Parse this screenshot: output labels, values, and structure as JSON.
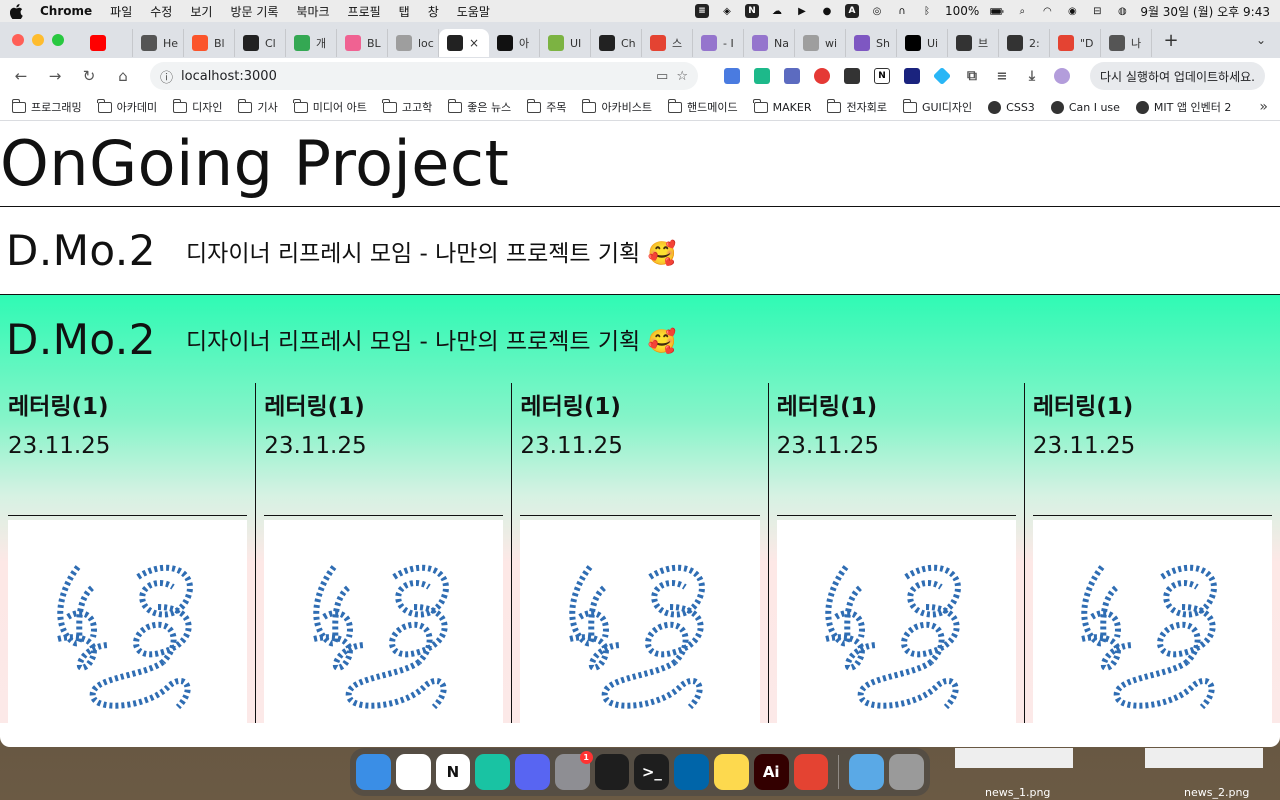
{
  "menubar": {
    "app_name": "Chrome",
    "menus": [
      "파일",
      "수정",
      "보기",
      "방문 기록",
      "북마크",
      "프로필",
      "탭",
      "창",
      "도움말"
    ],
    "battery": "100%",
    "datetime": "9월 30일 (월) 오후 9:43"
  },
  "tabs": [
    {
      "label": "",
      "icon": "youtube-icon",
      "color": "#ff0000"
    },
    {
      "label": "He",
      "icon": "chatgpt-icon",
      "color": "#555555"
    },
    {
      "label": "Bl",
      "icon": "brave-icon",
      "color": "#fb542b"
    },
    {
      "label": "Cl",
      "icon": "chatgpt-icon",
      "color": "#222222"
    },
    {
      "label": "개",
      "icon": "maps-icon",
      "color": "#34a853"
    },
    {
      "label": "BL",
      "icon": "bookmark-icon",
      "color": "#f06292"
    },
    {
      "label": "loc",
      "icon": "globe-icon",
      "color": "#9e9e9e"
    },
    {
      "label": "×",
      "icon": "react-icon",
      "color": "#222222",
      "active": true
    },
    {
      "label": "아",
      "icon": "app-icon",
      "color": "#111111"
    },
    {
      "label": "UI",
      "icon": "smile-icon",
      "color": "#7cb342"
    },
    {
      "label": "Ch",
      "icon": "chatgpt-icon",
      "color": "#222222"
    },
    {
      "label": "스",
      "icon": "todoist-icon",
      "color": "#e44332"
    },
    {
      "label": "- I",
      "icon": "stack-icon",
      "color": "#9575cd"
    },
    {
      "label": "Na",
      "icon": "stack-icon",
      "color": "#9575cd"
    },
    {
      "label": "wi",
      "icon": "globe-icon",
      "color": "#9e9e9e"
    },
    {
      "label": "Sh",
      "icon": "gradient-icon",
      "color": "#7e57c2"
    },
    {
      "label": "Ui",
      "icon": "notion-icon",
      "color": "#000000"
    },
    {
      "label": "브",
      "icon": "linear-icon",
      "color": "#333333"
    },
    {
      "label": "2:",
      "icon": "linear-icon",
      "color": "#333333"
    },
    {
      "label": "\"D",
      "icon": "todoist-icon",
      "color": "#e44332"
    },
    {
      "label": "나",
      "icon": "github-icon",
      "color": "#555555"
    }
  ],
  "toolbar": {
    "url": "localhost:3000",
    "update_label": "다시 실행하여 업데이트하세요."
  },
  "bookmarks": [
    {
      "label": "프로그래밍",
      "type": "folder"
    },
    {
      "label": "아카데미",
      "type": "folder"
    },
    {
      "label": "디자인",
      "type": "folder"
    },
    {
      "label": "기사",
      "type": "folder"
    },
    {
      "label": "미디어 아트",
      "type": "folder"
    },
    {
      "label": "고고학",
      "type": "folder"
    },
    {
      "label": "좋은 뉴스",
      "type": "folder"
    },
    {
      "label": "주목",
      "type": "folder"
    },
    {
      "label": "아카비스트",
      "type": "folder"
    },
    {
      "label": "핸드메이드",
      "type": "folder"
    },
    {
      "label": "MAKER",
      "type": "folder"
    },
    {
      "label": "전자회로",
      "type": "folder"
    },
    {
      "label": "GUI디자인",
      "type": "folder"
    },
    {
      "label": "CSS3",
      "type": "site"
    },
    {
      "label": "Can I use",
      "type": "site"
    },
    {
      "label": "MIT 앱 인벤터 2",
      "type": "site"
    }
  ],
  "page": {
    "title": "OnGoing Project",
    "projects": [
      {
        "code": "D.Mo.2",
        "description": "디자이너 리프레시 모임 - 나만의 프로젝트 기획 🥰"
      },
      {
        "code": "D.Mo.2",
        "description": "디자이너 리프레시 모임 - 나만의 프로젝트 기획 🥰"
      }
    ],
    "cards": [
      {
        "title": "레터링(1)",
        "date": "23.11.25"
      },
      {
        "title": "레터링(1)",
        "date": "23.11.25"
      },
      {
        "title": "레터링(1)",
        "date": "23.11.25"
      },
      {
        "title": "레터링(1)",
        "date": "23.11.25"
      },
      {
        "title": "레터링(1)",
        "date": "23.11.25"
      }
    ],
    "accent_color": "#2ffab4",
    "lettering_color": "#2f6db3"
  },
  "dock": {
    "apps": [
      {
        "name": "finder-icon",
        "color": "#3a8ee6",
        "label": ""
      },
      {
        "name": "chrome-icon",
        "color": "#ffffff",
        "label": ""
      },
      {
        "name": "notion-icon",
        "color": "#ffffff",
        "label": "N"
      },
      {
        "name": "chatgpt-icon",
        "color": "#19c3a3",
        "label": ""
      },
      {
        "name": "discord-icon",
        "color": "#5865f2",
        "label": ""
      },
      {
        "name": "settings-icon",
        "color": "#8e8e93",
        "label": "",
        "badge": "1"
      },
      {
        "name": "figma-icon",
        "color": "#1e1e1e",
        "label": ""
      },
      {
        "name": "terminal-icon",
        "color": "#1e1e1e",
        "label": ">_"
      },
      {
        "name": "vscode-icon",
        "color": "#0065a9",
        "label": ""
      },
      {
        "name": "notes-icon",
        "color": "#fdd94e",
        "label": ""
      },
      {
        "name": "illustrator-icon",
        "color": "#330000",
        "label": "Ai"
      },
      {
        "name": "todoist-icon",
        "color": "#e44332",
        "label": ""
      },
      {
        "name": "downloads-icon",
        "color": "#5aa9e6",
        "label": "",
        "after_separator": true
      },
      {
        "name": "trash-icon",
        "color": "#9a9a9a",
        "label": ""
      }
    ]
  },
  "desktop": {
    "files": [
      "news_1.png",
      "news_2.png"
    ]
  }
}
